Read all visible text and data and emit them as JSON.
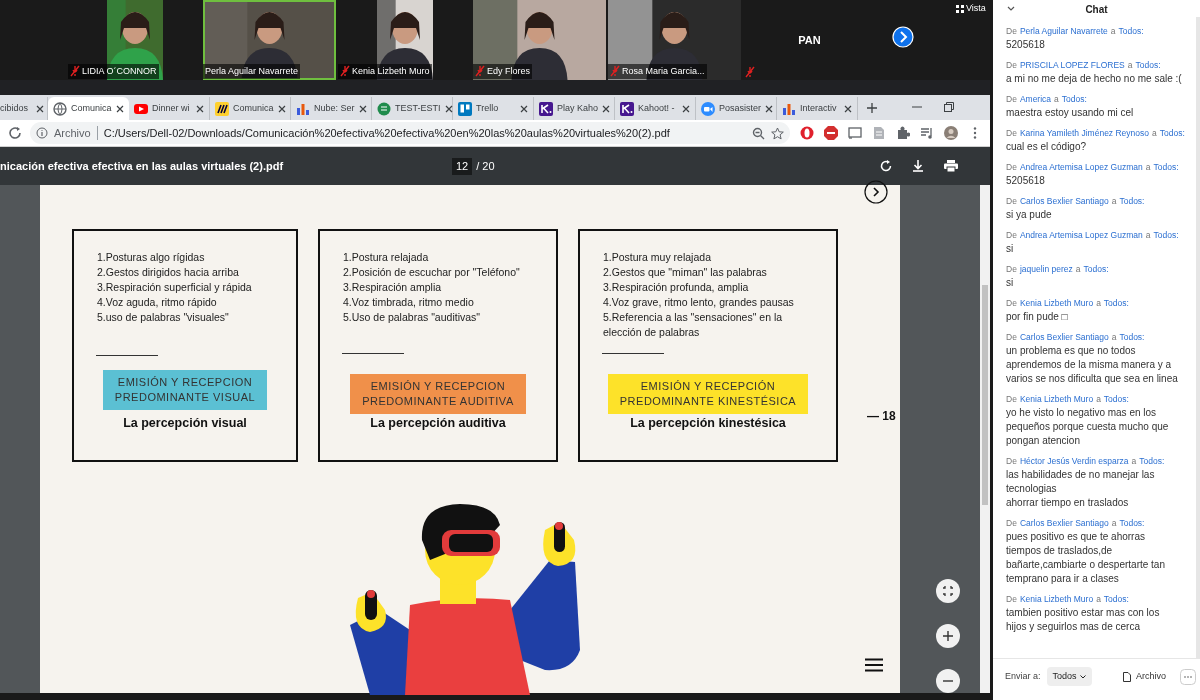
{
  "meeting": {
    "view_label": "Vista",
    "tiles": [
      {
        "kind": "portrait",
        "name": "LIDIA O´CONNOR",
        "muted": true,
        "speaking": false
      },
      {
        "kind": "video",
        "name": "Perla Aguilar Navarrete",
        "muted": false,
        "speaking": true
      },
      {
        "kind": "portrait",
        "name": "Kenia Lizbeth Muro",
        "muted": true,
        "speaking": false
      },
      {
        "kind": "video",
        "name": "Edy Flores",
        "muted": true,
        "speaking": false
      },
      {
        "kind": "video",
        "name": "Rosa Maria Garcia...",
        "muted": true,
        "speaking": false
      },
      {
        "kind": "name_only",
        "name": "PAN",
        "muted": true,
        "speaking": false
      }
    ]
  },
  "browser": {
    "tabs": [
      {
        "kind": "plain",
        "label": "cibidos",
        "selected": false
      },
      {
        "kind": "globe",
        "label": "Comunica",
        "selected": true
      },
      {
        "kind": "youtube",
        "label": "Dinner wi",
        "selected": false
      },
      {
        "kind": "miro",
        "label": "Comunica",
        "selected": false
      },
      {
        "kind": "chart",
        "label": "Nube: Ser",
        "selected": false
      },
      {
        "kind": "circle",
        "label": "TEST-ESTI",
        "selected": false
      },
      {
        "kind": "trello",
        "label": "Trello",
        "selected": false
      },
      {
        "kind": "kahoot",
        "label": "Play Kaho",
        "selected": false
      },
      {
        "kind": "kahoot",
        "label": "Kahoot! -",
        "selected": false
      },
      {
        "kind": "zoom",
        "label": "Posasister",
        "selected": false
      },
      {
        "kind": "chart",
        "label": "Interactiv",
        "selected": false
      }
    ],
    "address": {
      "scheme": "Archivo",
      "url": "C:/Users/Dell-02/Downloads/Comunicación%20efectiva%20efectiva%20en%20las%20aulas%20virtuales%20(2).pdf"
    }
  },
  "pdf": {
    "title": "nicación efectiva efectiva en las aulas virtuales (2).pdf",
    "page": "12",
    "total": "/ 20",
    "page_number": "— 18",
    "cards": [
      {
        "items": [
          "1.Posturas algo rígidas",
          "2.Gestos dirigidos hacia arriba",
          "3.Respiración superficial y rápida",
          "4.Voz aguda, ritmo rápido",
          "5.uso de palabras \"visuales\""
        ],
        "badge": "EMISIÓN Y RECEPCION\nPREDOMINANTE VISUAL",
        "color": "#5bc0d3",
        "caption": "La percepción visual"
      },
      {
        "items": [
          "1.Postura relajada",
          "2.Posición de escuchar por \"Teléfono\"",
          "3.Respiración amplia",
          "4.Voz timbrada, ritmo medio",
          "5.Uso de palabras \"auditivas\""
        ],
        "badge": "EMISIÓN Y RECEPCION\nPREDOMINANTE AUDITIVA",
        "color": "#f0904a",
        "caption": "La percepción auditiva"
      },
      {
        "items": [
          "1.Postura muy relajada",
          "2.Gestos que \"miman\" las palabras",
          "3.Respiración profunda, amplia",
          "4.Voz grave, ritmo lento, grandes pausas",
          "5.Referencia a las \"sensaciones\" en la elección de palabras"
        ],
        "badge": "EMISIÓN Y RECEPCIÓN\nPREDOMINANTE KINESTÉSICA",
        "color": "#fde229",
        "caption": "La percepción kinestésica"
      }
    ]
  },
  "chat": {
    "title": "Chat",
    "messages": [
      {
        "from_label": "De",
        "from": "Perla Aguilar Navarrete",
        "to_label": "a",
        "to": "Todos:",
        "text": "5205618"
      },
      {
        "from_label": "De",
        "from": "PRISCILA LOPEZ FLORES",
        "to_label": "a",
        "to": "Todos:",
        "text": "a mi no me deja de hecho no me sale :("
      },
      {
        "from_label": "De",
        "from": "America",
        "to_label": "a",
        "to": "Todos:",
        "text": "maestra estoy usando mi cel"
      },
      {
        "from_label": "De",
        "from": "Karina Yamileth Jiménez Reynoso",
        "to_label": "a",
        "to": "Todos:",
        "text": "cual es el código?"
      },
      {
        "from_label": "De",
        "from": "Andrea Artemisa Lopez Guzman",
        "to_label": "a",
        "to": "Todos:",
        "text": "5205618"
      },
      {
        "from_label": "De",
        "from": "Carlos Bexlier Santiago",
        "to_label": "a",
        "to": "Todos:",
        "text": "si ya pude"
      },
      {
        "from_label": "De",
        "from": "Andrea Artemisa Lopez Guzman",
        "to_label": "a",
        "to": "Todos:",
        "text": "si"
      },
      {
        "from_label": "De",
        "from": "jaquelin perez",
        "to_label": "a",
        "to": "Todos:",
        "text": "si"
      },
      {
        "from_label": "De",
        "from": "Kenia Lizbeth Muro",
        "to_label": "a",
        "to": "Todos:",
        "text": "por fin pude □"
      },
      {
        "from_label": "De",
        "from": "Carlos Bexlier Santiago",
        "to_label": "a",
        "to": "Todos:",
        "text": "un problema es que no todos aprendemos de la misma manera y a varios se nos dificulta que sea en linea"
      },
      {
        "from_label": "De",
        "from": "Kenia Lizbeth Muro",
        "to_label": "a",
        "to": "Todos:",
        "text": "yo he visto lo negativo mas en los pequeños porque cuesta mucho que pongan atencion"
      },
      {
        "from_label": "De",
        "from": "Héctor Jesús Verdin esparza",
        "to_label": "a",
        "to": "Todos:",
        "text": "las habilidades de no manejar las tecnologias\nahorrar tiempo en traslados"
      },
      {
        "from_label": "De",
        "from": "Carlos Bexlier Santiago",
        "to_label": "a",
        "to": "Todos:",
        "text": "pues positivo es que te ahorras tiempos de traslados,de bañarte,cambiarte o despertarte tan temprano para ir a clases"
      },
      {
        "from_label": "De",
        "from": "Kenia Lizbeth Muro",
        "to_label": "a",
        "to": "Todos:",
        "text": "tambien positivo estar mas con los hijos y seguirlos mas de cerca"
      }
    ],
    "send_label": "Enviar a:",
    "recipient": "Todos",
    "file_label": "Archivo"
  }
}
